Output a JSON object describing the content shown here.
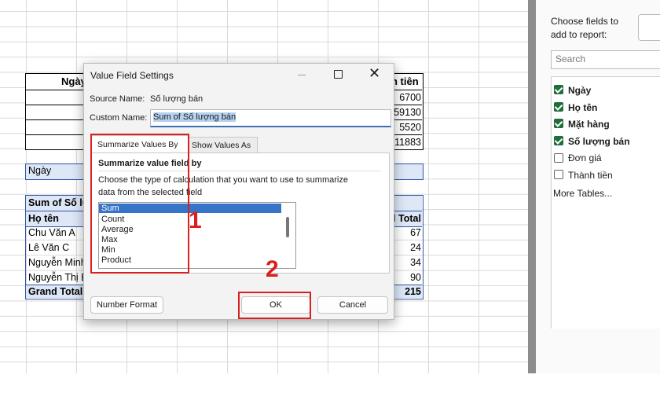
{
  "sheet": {
    "table1": {
      "header_left": "Ngày",
      "header_right": "h tiên",
      "values": [
        "6700",
        "59130",
        "5520",
        "11883"
      ]
    },
    "filter_label": "Ngày",
    "pivot": {
      "title": "Sum of Số lu",
      "col1_header": "Họ tên",
      "col2_header": "l Total",
      "rows": [
        {
          "name": "Chu Văn A",
          "value": "67"
        },
        {
          "name": "Lê Văn C",
          "value": "24"
        },
        {
          "name": "Nguyễn Minh",
          "value": "34"
        },
        {
          "name": "Nguyễn Thị B",
          "value": "90"
        }
      ],
      "grand_total_label": "Grand Total",
      "grand_total_value": "215"
    }
  },
  "dialog": {
    "title": "Value Field Settings",
    "source_name_label": "Source Name:",
    "source_name_value": "Số lượng bán",
    "custom_name_label": "Custom Name:",
    "custom_name_value": "Sum of Số lượng bán",
    "tab_summarize": "Summarize Values By",
    "tab_show": "Show Values As",
    "section_heading": "Summarize value field by",
    "description_line1": "Choose the type of calculation that you want to use to summarize",
    "description_line2": "data from the selected field",
    "functions": [
      "Sum",
      "Count",
      "Average",
      "Max",
      "Min",
      "Product"
    ],
    "selected_function": "Sum",
    "number_format_label": "Number Format",
    "ok_label": "OK",
    "cancel_label": "Cancel"
  },
  "annotations": {
    "step1": "1",
    "step2": "2",
    "color": "#d9201f"
  },
  "field_panel": {
    "heading_line1": "Choose fields to",
    "heading_line2": "add to report:",
    "search_placeholder": "Search",
    "fields": [
      {
        "label": "Ngày",
        "checked": true
      },
      {
        "label": "Họ tên",
        "checked": true
      },
      {
        "label": "Mặt hàng",
        "checked": true
      },
      {
        "label": "Số lượng bán",
        "checked": true
      },
      {
        "label": "Đơn giá",
        "checked": false
      },
      {
        "label": "Thành tiền",
        "checked": false
      }
    ],
    "more_tables": "More Tables..."
  }
}
